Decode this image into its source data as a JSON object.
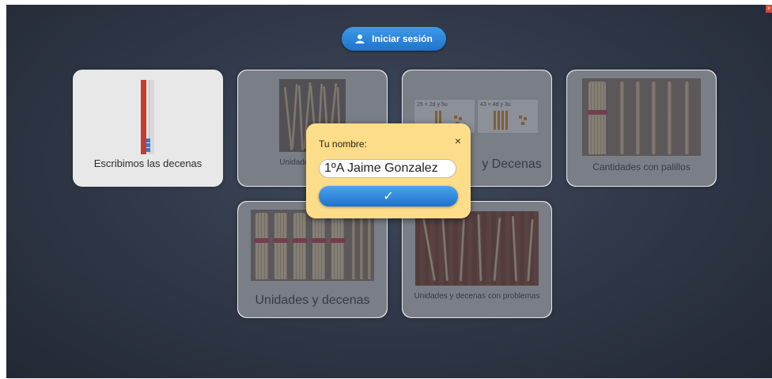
{
  "header": {
    "login_label": "Iniciar sesión",
    "login_icon": "user-icon"
  },
  "cards": [
    {
      "label": "Escribimos las decenas"
    },
    {
      "label": "Unidades y grupos"
    },
    {
      "label": "y Decenas",
      "panel_left": [
        "25 =",
        "2d",
        "y",
        "5u"
      ],
      "panel_right": [
        "43 =",
        "4d",
        "y",
        "3u"
      ]
    },
    {
      "label": "Cantidades con palillos"
    },
    {
      "label": "Unidades y decenas"
    },
    {
      "label": "Unidades y decenas con problemas"
    }
  ],
  "dialog": {
    "title": "Tu nombre:",
    "close": "×",
    "name_value": "1ºA Jaime Gonzalez",
    "confirm": "✓"
  },
  "colors": {
    "accent_blue": "#2a86dc",
    "dialog_bg": "#fddd8a",
    "background": "#2f3646"
  }
}
